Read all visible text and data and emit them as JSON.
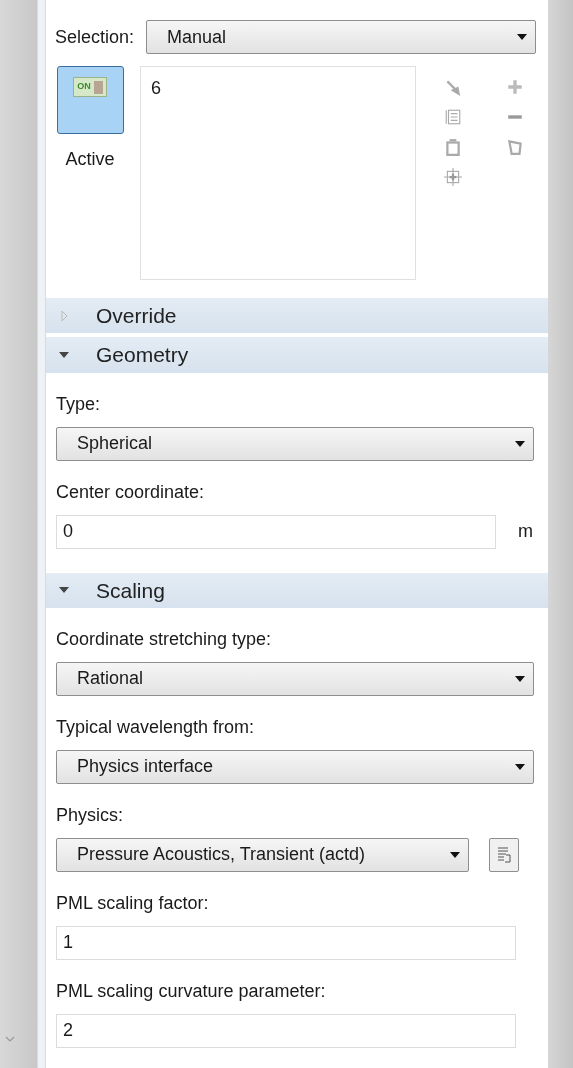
{
  "selection": {
    "label": "Selection:",
    "value": "Manual"
  },
  "active_button": {
    "icon_text": "ON",
    "label": "Active",
    "on": true
  },
  "selection_list": {
    "items": [
      "6"
    ]
  },
  "sections": [
    {
      "title": "Override",
      "expanded": false
    },
    {
      "title": "Geometry",
      "expanded": true,
      "fields": [
        {
          "kind": "dropdown",
          "label": "Type:",
          "value": "Spherical"
        },
        {
          "kind": "input",
          "label": "Center coordinate:",
          "value": "0",
          "unit": "m"
        }
      ]
    },
    {
      "title": "Scaling",
      "expanded": true,
      "fields": [
        {
          "kind": "dropdown",
          "label": "Coordinate stretching type:",
          "value": "Rational"
        },
        {
          "kind": "dropdown",
          "label": "Typical wavelength from:",
          "value": "Physics interface"
        },
        {
          "kind": "dropdown_button",
          "label": "Physics:",
          "value": "Pressure Acoustics, Transient (actd)"
        },
        {
          "kind": "input",
          "label": "PML scaling factor:",
          "value": "1"
        },
        {
          "kind": "input",
          "label": "PML scaling curvature parameter:",
          "value": "2"
        }
      ]
    }
  ]
}
